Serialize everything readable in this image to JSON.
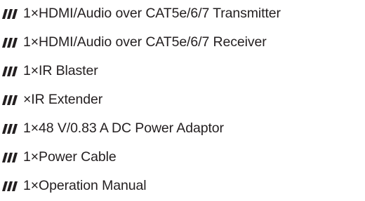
{
  "package_contents": {
    "bullet_icon": "triple-slash-icon",
    "bullet_color": "#231f20",
    "items": [
      "1×HDMI/Audio over CAT5e/6/7 Transmitter",
      "1×HDMI/Audio over CAT5e/6/7 Receiver",
      "1×IR Blaster",
      "×IR Extender",
      "1×48 V/0.83 A DC Power Adaptor",
      "1×Power Cable",
      "1×Operation Manual"
    ]
  }
}
